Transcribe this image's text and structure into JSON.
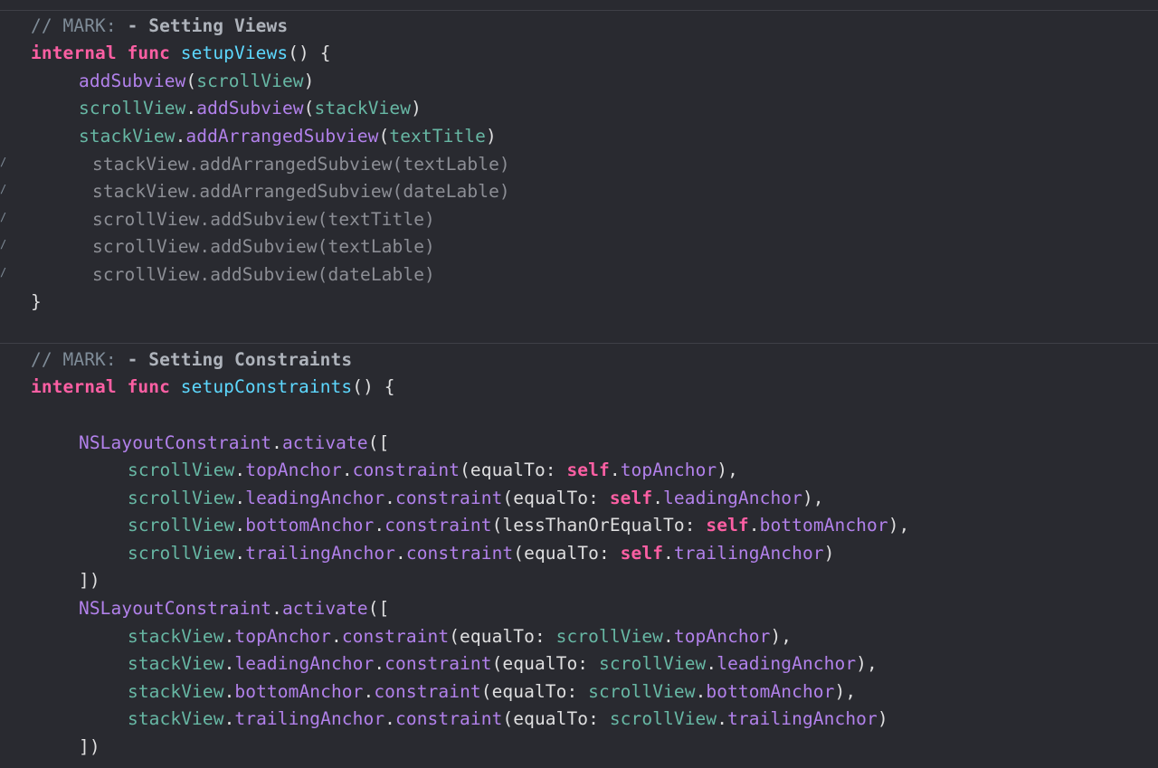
{
  "colors": {
    "background": "#292a30",
    "comment": "#7f8c98",
    "keyword": "#fc5fa3",
    "declaration": "#5dd8ff",
    "function": "#b281eb",
    "property": "#67b7a4",
    "plain": "#dfdfe0"
  },
  "section1": {
    "mark_prefix": "// MARK: ",
    "mark_title": "- Setting Views",
    "kw_internal": "internal",
    "kw_func": "func",
    "func_name": "setupViews",
    "func_sig_end": "() {",
    "line1": {
      "fn": "addSubview",
      "open": "(",
      "arg": "scrollView",
      "close": ")"
    },
    "line2": {
      "obj": "scrollView",
      "dot": ".",
      "fn": "addSubview",
      "open": "(",
      "arg": "stackView",
      "close": ")"
    },
    "line3": {
      "obj": "stackView",
      "dot": ".",
      "fn": "addArrangedSubview",
      "open": "(",
      "arg": "textTitle",
      "close": ")"
    },
    "commented_lines": [
      "stackView.addArrangedSubview(textLable)",
      "stackView.addArrangedSubview(dateLable)",
      "scrollView.addSubview(textTitle)",
      "scrollView.addSubview(textLable)",
      "scrollView.addSubview(dateLable)"
    ],
    "gutter_mark": "/",
    "close_brace": "}"
  },
  "section2": {
    "mark_prefix": "// MARK: ",
    "mark_title": "- Setting Constraints",
    "kw_internal": "internal",
    "kw_func": "func",
    "func_name": "setupConstraints",
    "func_sig_end": "() {",
    "block1": {
      "class": "NSLayoutConstraint",
      "dot": ".",
      "fn": "activate",
      "open": "([",
      "rows": [
        {
          "obj": "scrollView",
          "anchor": "topAnchor",
          "fn": "constraint",
          "label": "(equalTo: ",
          "self": "self",
          "target": "topAnchor",
          "end": "),"
        },
        {
          "obj": "scrollView",
          "anchor": "leadingAnchor",
          "fn": "constraint",
          "label": "(equalTo: ",
          "self": "self",
          "target": "leadingAnchor",
          "end": "),"
        },
        {
          "obj": "scrollView",
          "anchor": "bottomAnchor",
          "fn": "constraint",
          "label": "(lessThanOrEqualTo: ",
          "self": "self",
          "target": "bottomAnchor",
          "end": "),"
        },
        {
          "obj": "scrollView",
          "anchor": "trailingAnchor",
          "fn": "constraint",
          "label": "(equalTo: ",
          "self": "self",
          "target": "trailingAnchor",
          "end": ")"
        }
      ],
      "close": "])"
    },
    "block2": {
      "class": "NSLayoutConstraint",
      "dot": ".",
      "fn": "activate",
      "open": "([",
      "rows": [
        {
          "obj": "stackView",
          "anchor": "topAnchor",
          "fn": "constraint",
          "label": "(equalTo: ",
          "ref": "scrollView",
          "target": "topAnchor",
          "end": "),"
        },
        {
          "obj": "stackView",
          "anchor": "leadingAnchor",
          "fn": "constraint",
          "label": "(equalTo: ",
          "ref": "scrollView",
          "target": "leadingAnchor",
          "end": "),"
        },
        {
          "obj": "stackView",
          "anchor": "bottomAnchor",
          "fn": "constraint",
          "label": "(equalTo: ",
          "ref": "scrollView",
          "target": "bottomAnchor",
          "end": "),"
        },
        {
          "obj": "stackView",
          "anchor": "trailingAnchor",
          "fn": "constraint",
          "label": "(equalTo: ",
          "ref": "scrollView",
          "target": "trailingAnchor",
          "end": ")"
        }
      ],
      "close": "])"
    }
  }
}
